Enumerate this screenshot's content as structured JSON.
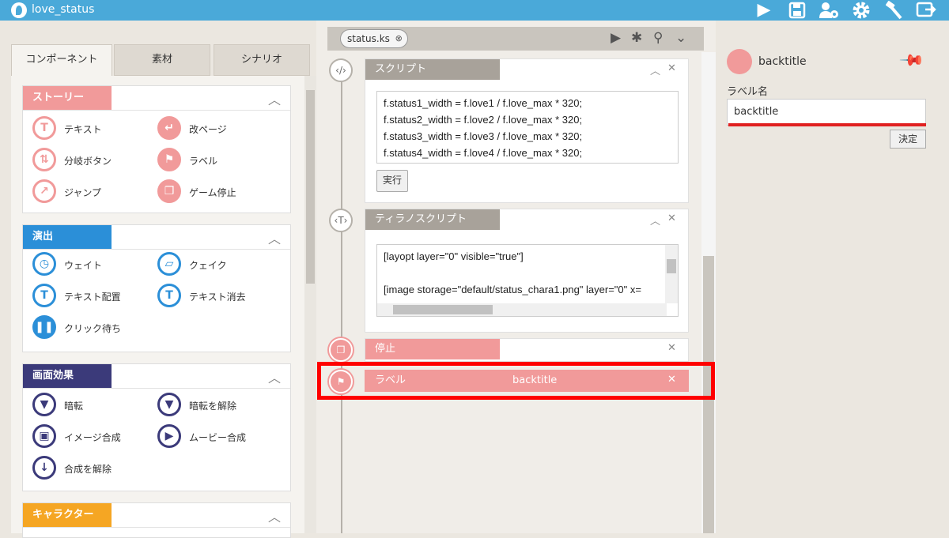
{
  "app": {
    "title": "love_status"
  },
  "toolbar": {
    "icons": [
      "play-icon",
      "save-icon",
      "users-gear-icon",
      "gear-icon",
      "tools-icon",
      "export-icon"
    ]
  },
  "left_tabs": [
    "コンポーネント",
    "素材",
    "シナリオ"
  ],
  "groups": {
    "story": {
      "title": "ストーリー",
      "color": "#f19a9a",
      "items": [
        "テキスト",
        "改ページ",
        "分岐ボタン",
        "ラベル",
        "ジャンプ",
        "ゲーム停止"
      ]
    },
    "effects": {
      "title": "演出",
      "color": "#2b8fd8",
      "items": [
        "ウェイト",
        "クェイク",
        "テキスト配置",
        "テキスト消去",
        "クリック待ち"
      ]
    },
    "screen": {
      "title": "画面効果",
      "color": "#3b3a7a",
      "items": [
        "暗転",
        "暗転を解除",
        "イメージ合成",
        "ムービー合成",
        "合成を解除"
      ]
    },
    "character": {
      "title": "キャラクター",
      "color": "#f5a623"
    }
  },
  "file_tab": {
    "name": "status.ks"
  },
  "blocks": {
    "script": {
      "title": "スクリプト",
      "lines": [
        "f.status1_width = f.love1 / f.love_max * 320;",
        "f.status2_width = f.love2 / f.love_max * 320;",
        "f.status3_width = f.love3 / f.love_max * 320;",
        "f.status4_width = f.love4 / f.love_max * 320;"
      ],
      "run_label": "実行"
    },
    "tyrano": {
      "title": "ティラノスクリプト",
      "lines": [
        "[layopt layer=\"0\" visible=\"true\"]",
        "",
        "[image storage=\"default/status_chara1.png\" layer=\"0\" x="
      ]
    },
    "stop": {
      "title": "停止"
    },
    "label": {
      "title": "ラベル",
      "value": "backtitle"
    }
  },
  "right": {
    "title": "backtitle",
    "field_label": "ラベル名",
    "field_value": "backtitle",
    "confirm_label": "決定"
  }
}
